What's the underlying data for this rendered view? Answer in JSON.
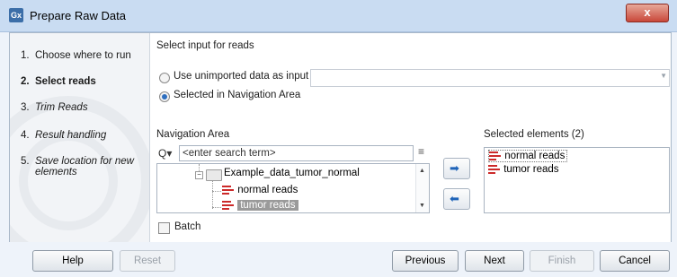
{
  "window": {
    "title": "Prepare Raw Data",
    "app_icon_label": "Gx",
    "close_label": "x"
  },
  "steps": [
    {
      "num": "1.",
      "label": "Choose where to run",
      "style": "normal"
    },
    {
      "num": "2.",
      "label": "Select reads",
      "style": "bold"
    },
    {
      "num": "3.",
      "label": "Trim Reads",
      "style": "italic"
    },
    {
      "num": "4.",
      "label": "Result handling",
      "style": "italic"
    },
    {
      "num": "5.",
      "label": "Save location for new elements",
      "style": "italic"
    }
  ],
  "main": {
    "section_title": "Select input for reads",
    "radio_unimported": "Use unimported data as input",
    "radio_navigation": "Selected in Navigation Area",
    "nav_area_label": "Navigation Area",
    "search_placeholder": "<enter search term>",
    "tree": {
      "folder": "Example_data_tumor_normal",
      "items": [
        "normal reads",
        "tumor reads"
      ]
    },
    "selected_label": "Selected elements (2)",
    "selected_items": [
      "normal reads",
      "tumor reads"
    ],
    "batch_label": "Batch"
  },
  "footer": {
    "help": "Help",
    "reset": "Reset",
    "previous": "Previous",
    "next": "Next",
    "finish": "Finish",
    "cancel": "Cancel"
  },
  "icons": {
    "search": "search-icon",
    "filter": "filter-icon",
    "add": "arrow-right-icon",
    "remove": "arrow-left-icon",
    "reads": "sequence-list-icon"
  },
  "colors": {
    "accent": "#2e6fbf",
    "reads_icon": "#cc2a2a",
    "titlebar": "#c9dcf2"
  }
}
